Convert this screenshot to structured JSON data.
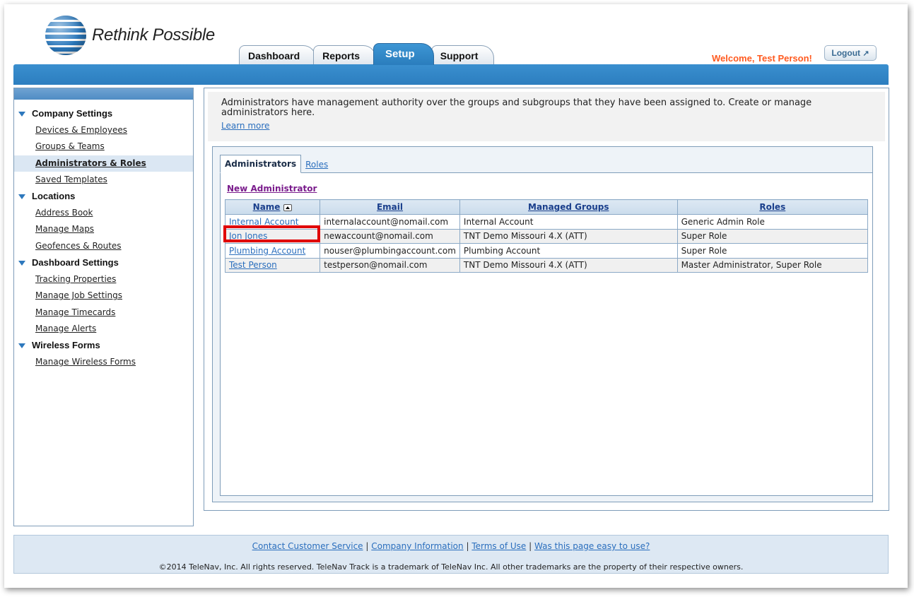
{
  "header": {
    "logo_text": "Rethink Possible",
    "tabs": [
      {
        "label": "Dashboard"
      },
      {
        "label": "Reports"
      },
      {
        "label": "Setup",
        "active": true
      },
      {
        "label": "Support"
      }
    ],
    "welcome": "Welcome, Test Person!",
    "logout_label": "Logout"
  },
  "sidebar": {
    "sections": [
      {
        "title": "Company Settings",
        "items": [
          "Devices & Employees",
          "Groups & Teams",
          "Administrators & Roles",
          "Saved Templates"
        ]
      },
      {
        "title": "Locations",
        "items": [
          "Address Book",
          "Manage Maps",
          "Geofences & Routes"
        ]
      },
      {
        "title": "Dashboard Settings",
        "items": [
          "Tracking Properties",
          "Manage Job Settings",
          "Manage Timecards",
          "Manage Alerts"
        ]
      },
      {
        "title": "Wireless Forms",
        "items": [
          "Manage Wireless Forms"
        ]
      }
    ],
    "active_item": "Administrators & Roles"
  },
  "main": {
    "intro": "Administrators have management authority over the groups and subgroups that they have been assigned to. Create or manage administrators here.",
    "learn_more": "Learn more",
    "tabs": [
      "Administrators",
      "Roles"
    ],
    "new_admin": "New Administrator",
    "table": {
      "headers": [
        "Name",
        "Email",
        "Managed Groups",
        "Roles"
      ],
      "rows": [
        [
          "Internal Account",
          "internalaccount@nomail.com",
          "Internal Account",
          "Generic Admin Role"
        ],
        [
          "Jon Jones",
          "newaccount@nomail.com",
          "TNT Demo Missouri 4.X (ATT)",
          "Super Role"
        ],
        [
          "Plumbing Account",
          "nouser@plumbingaccount.com",
          "Plumbing Account",
          "Super Role"
        ],
        [
          "Test Person",
          "testperson@nomail.com",
          "TNT Demo Missouri 4.X (ATT)",
          "Master Administrator, Super Role"
        ]
      ]
    }
  },
  "footer": {
    "links": [
      "Contact Customer Service",
      "Company Information",
      "Terms of Use",
      "Was this page easy to use?"
    ],
    "separator": "|",
    "copyright": "©2014 TeleNav, Inc. All rights reserved. TeleNav Track is a trademark of TeleNav Inc. All other trademarks are the property of their respective owners."
  },
  "colors": {
    "brand_blue": "#2c7ebf",
    "welcome_orange": "#ff5a1f",
    "link_blue": "#2a6ebd",
    "highlight_red": "#e00000"
  }
}
